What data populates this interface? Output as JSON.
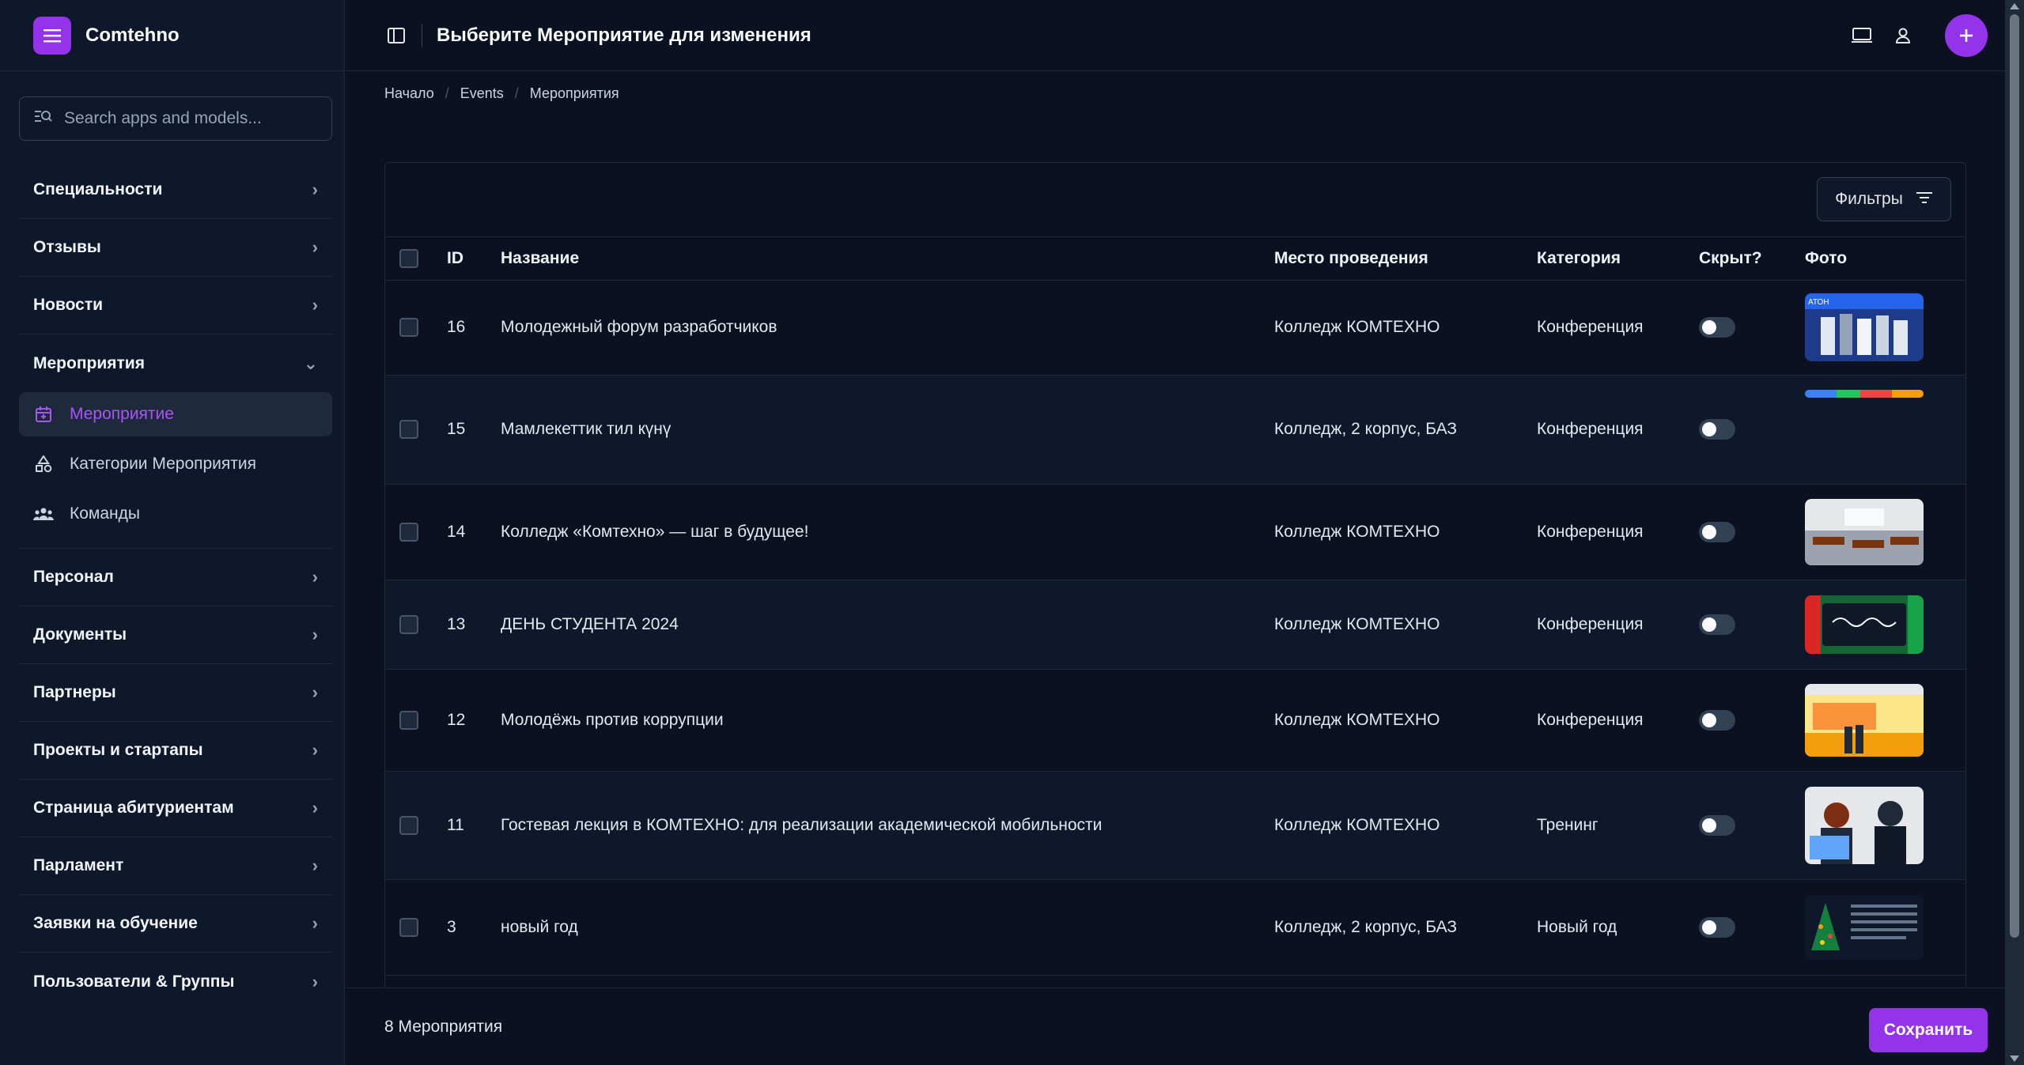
{
  "app": {
    "brand": "Comtehno",
    "accent": "#9333ea"
  },
  "search": {
    "placeholder": "Search apps and models..."
  },
  "sidebar": {
    "groups_top": [
      {
        "label": "Специальности"
      },
      {
        "label": "Отзывы"
      },
      {
        "label": "Новости"
      }
    ],
    "open_group": {
      "label": "Мероприятия",
      "items": [
        {
          "label": "Мероприятие",
          "icon": "calendar-icon",
          "active": true
        },
        {
          "label": "Категории Мероприятия",
          "icon": "shapes-icon",
          "active": false
        },
        {
          "label": "Команды",
          "icon": "users-icon",
          "active": false
        }
      ]
    },
    "groups_bottom": [
      {
        "label": "Персонал"
      },
      {
        "label": "Документы"
      },
      {
        "label": "Партнеры"
      },
      {
        "label": "Проекты и стартапы"
      },
      {
        "label": "Страница абитуриентам"
      },
      {
        "label": "Парламент"
      },
      {
        "label": "Заявки на обучение"
      },
      {
        "label": "Пользователи & Группы"
      }
    ]
  },
  "header": {
    "title": "Выберите Мероприятие для изменения"
  },
  "breadcrumb": [
    "Начало",
    "Events",
    "Мероприятия"
  ],
  "filters": {
    "label": "Фильтры"
  },
  "table": {
    "columns": [
      "ID",
      "Название",
      "Место проведения",
      "Категория",
      "Скрыт?",
      "Фото"
    ],
    "rows": [
      {
        "id": "16",
        "name": "Молодежный форум разработчиков",
        "venue": "Колледж КОМТЕХНО",
        "category": "Конференция",
        "hidden": false,
        "photo": "group-photo"
      },
      {
        "id": "15",
        "name": "Мамлекеттик тил күнү",
        "venue": "Колледж, 2 корпус, БАЗ",
        "category": "Конференция",
        "hidden": false,
        "photo": "colorful-banner"
      },
      {
        "id": "14",
        "name": "Колледж «Комтехно» — шаг в будущее!",
        "venue": "Колледж КОМТЕХНО",
        "category": "Конференция",
        "hidden": false,
        "photo": "classroom-photo"
      },
      {
        "id": "13",
        "name": "ДЕНЬ СТУДЕНТА 2024",
        "venue": "Колледж КОМТЕХНО",
        "category": "Конференция",
        "hidden": false,
        "photo": "students-day-card"
      },
      {
        "id": "12",
        "name": "Молодёжь против коррупции",
        "venue": "Колледж КОМТЕХНО",
        "category": "Конференция",
        "hidden": false,
        "photo": "presentation-photo"
      },
      {
        "id": "11",
        "name": "Гостевая лекция в КОМТЕХНО: для реализации академической мобильности",
        "venue": "Колледж КОМТЕХНО",
        "category": "Тренинг",
        "hidden": false,
        "photo": "lecture-photo"
      },
      {
        "id": "3",
        "name": "новый год",
        "venue": "Колледж, 2 корпус, БАЗ",
        "category": "Новый год",
        "hidden": false,
        "photo": "new-year-tree-card"
      }
    ]
  },
  "footer": {
    "count": "8 Мероприятия",
    "save_label": "Сохранить"
  }
}
